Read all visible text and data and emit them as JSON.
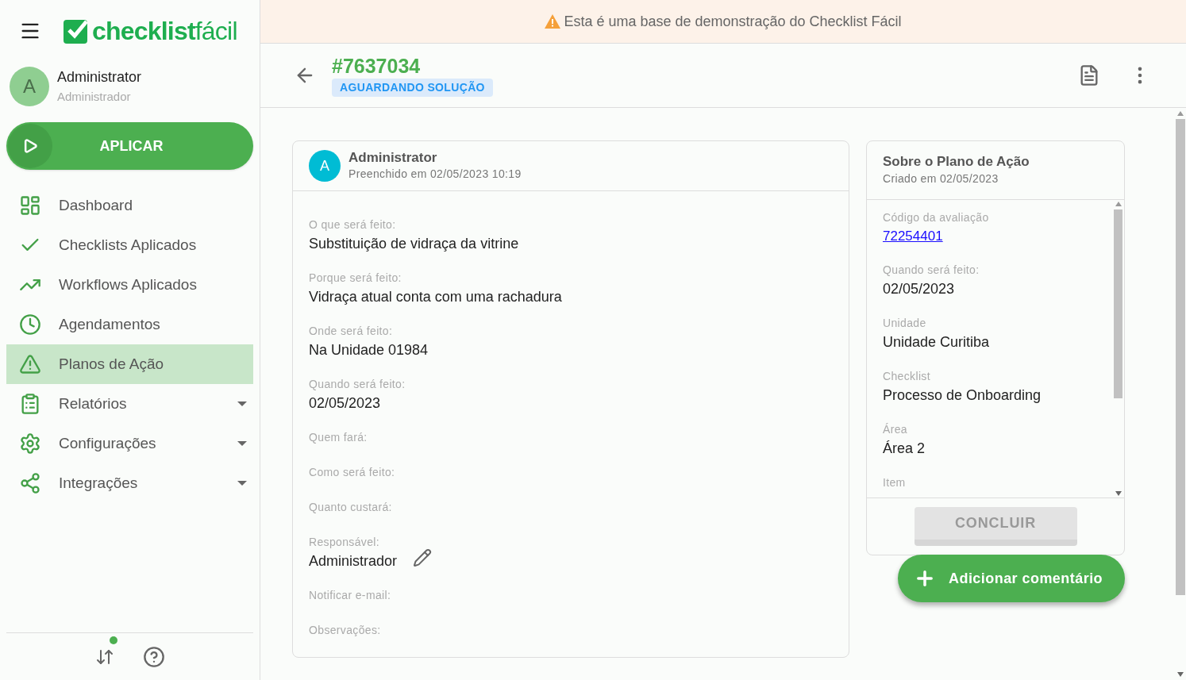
{
  "banner": {
    "text": "Esta é uma base de demonstração do Checklist Fácil"
  },
  "sidebar": {
    "logo": "**checklist**fácil",
    "user": {
      "initial": "A",
      "name": "Administrator",
      "role": "Administrador"
    },
    "apply_button": "APLICAR",
    "items": [
      {
        "label": "Dashboard",
        "selected": false,
        "kind": "link"
      },
      {
        "label": "Checklists Aplicados",
        "selected": false,
        "kind": "link"
      },
      {
        "label": "Workflows Aplicados",
        "selected": false,
        "kind": "link"
      },
      {
        "label": "Agendamentos",
        "selected": false,
        "kind": "link"
      },
      {
        "label": "Planos de Ação",
        "selected": true,
        "kind": "link"
      },
      {
        "label": "Relatórios",
        "selected": false,
        "kind": "menu"
      },
      {
        "label": "Configurações",
        "selected": false,
        "kind": "menu"
      },
      {
        "label": "Integrações",
        "selected": false,
        "kind": "menu"
      }
    ],
    "sync_pending": true
  },
  "header": {
    "title": "#7637034",
    "status": "AGUARDANDO SOLUÇÃO"
  },
  "detail_card": {
    "author_initial": "A",
    "author": "Administrator",
    "subtitle": "Preenchido em 02/05/2023 10:19",
    "fields": [
      {
        "label": "O que será feito:",
        "value": "Substituição de vidraça da vitrine",
        "editable": false
      },
      {
        "label": "Porque será feito:",
        "value": "Vidraça atual conta com uma rachadura",
        "editable": false
      },
      {
        "label": "Onde será feito:",
        "value": "Na Unidade 01984",
        "editable": false
      },
      {
        "label": "Quando será feito:",
        "value": "02/05/2023",
        "editable": false
      },
      {
        "label": "Quem fará:",
        "editable": false
      },
      {
        "label": "Como será feito:",
        "editable": false
      },
      {
        "label": "Quanto custará:",
        "editable": false
      },
      {
        "label": "Responsável:",
        "value": "Administrador",
        "editable": true
      },
      {
        "label": "Notificar e-mail:",
        "editable": false
      },
      {
        "label": "Observações:",
        "editable": false
      }
    ]
  },
  "about_card": {
    "title": "Sobre o Plano de Ação",
    "subtitle": "Criado em 02/05/2023",
    "fields": [
      {
        "label": "Código da avaliação",
        "value": "72254401",
        "kind": "link"
      },
      {
        "label": "Quando será feito:",
        "value": "02/05/2023",
        "kind": "text"
      },
      {
        "label": "Unidade",
        "value": "Unidade Curitiba",
        "kind": "text"
      },
      {
        "label": "Checklist",
        "value": "Processo de Onboarding",
        "kind": "text"
      },
      {
        "label": "Área",
        "value": "Área 2",
        "kind": "text"
      },
      {
        "label": "Item"
      }
    ],
    "conclude_button": {
      "label": "CONCLUIR",
      "disabled": true
    }
  },
  "fab": {
    "label": "Adicionar comentário"
  }
}
